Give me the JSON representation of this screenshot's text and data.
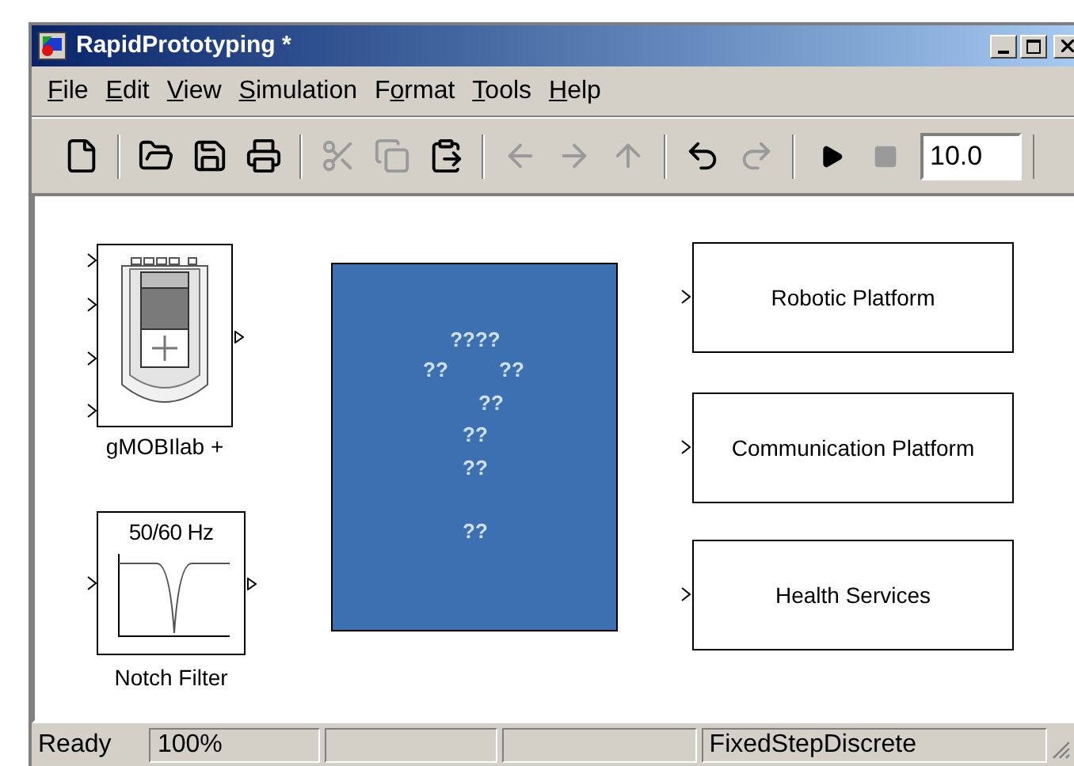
{
  "window": {
    "title": "RapidPrototyping *"
  },
  "menu": [
    {
      "key": "F",
      "post": "ile"
    },
    {
      "key": "E",
      "post": "dit"
    },
    {
      "key": "V",
      "post": "iew"
    },
    {
      "key": "S",
      "post": "imulation"
    },
    {
      "pre": "F",
      "key": "o",
      "post": "rmat"
    },
    {
      "key": "T",
      "post": "ools"
    },
    {
      "key": "H",
      "post": "elp"
    }
  ],
  "toolbar": [
    {
      "kind": "new",
      "disabled": false
    },
    {
      "kind": "separator"
    },
    {
      "kind": "open",
      "disabled": false
    },
    {
      "kind": "save",
      "disabled": false
    },
    {
      "kind": "print",
      "disabled": false
    },
    {
      "kind": "separator"
    },
    {
      "kind": "cut",
      "disabled": true
    },
    {
      "kind": "copy",
      "disabled": true
    },
    {
      "kind": "paste",
      "disabled": false
    },
    {
      "kind": "separator"
    },
    {
      "kind": "back",
      "disabled": true
    },
    {
      "kind": "forward",
      "disabled": true
    },
    {
      "kind": "up",
      "disabled": true
    },
    {
      "kind": "separator"
    },
    {
      "kind": "undo",
      "disabled": false
    },
    {
      "kind": "redo",
      "disabled": true
    },
    {
      "kind": "separator"
    },
    {
      "kind": "play",
      "disabled": false
    },
    {
      "kind": "stop",
      "disabled": true
    }
  ],
  "stop_time_field": {
    "value": "10.0"
  },
  "canvas": {
    "gmobilab_block": {
      "label": "gMOBIlab +"
    },
    "notch_filter_block": {
      "caption": "50/60 Hz",
      "label": "Notch Filter"
    },
    "annotation_block": {
      "lines": [
        [
          "????"
        ],
        [
          "??",
          "??"
        ],
        [
          "??"
        ],
        [
          "??"
        ],
        [
          "??"
        ],
        [
          "??"
        ]
      ]
    },
    "subsystems": [
      {
        "label": "Robotic Platform"
      },
      {
        "label": "Communication Platform"
      },
      {
        "label": "Health Services"
      }
    ]
  },
  "status_bar": {
    "status": "Ready",
    "panes": [
      {
        "kind": "text",
        "text": "100%"
      },
      {
        "kind": "empty"
      },
      {
        "kind": "empty"
      },
      {
        "kind": "text",
        "text": "FixedStepDiscrete"
      }
    ]
  }
}
